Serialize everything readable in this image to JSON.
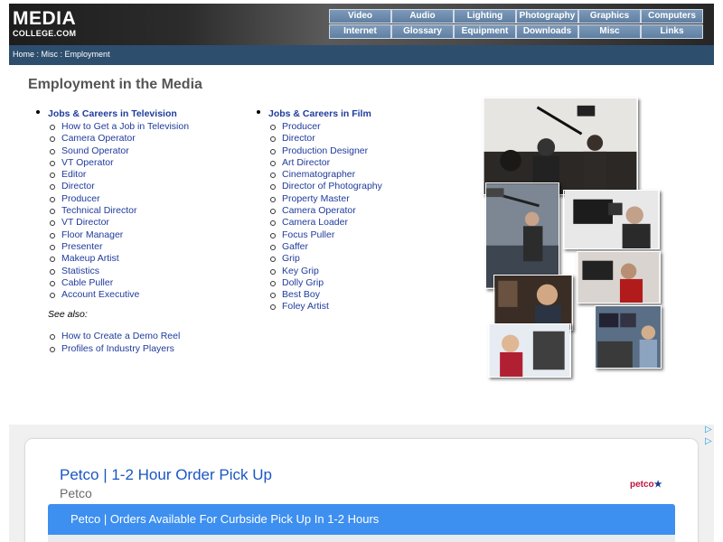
{
  "logo": {
    "line1": "MEDIA",
    "line2": "COLLEGE.COM"
  },
  "nav": [
    "Video",
    "Audio",
    "Lighting",
    "Photography",
    "Graphics",
    "Computers",
    "Internet",
    "Glossary",
    "Equipment",
    "Downloads",
    "Misc",
    "Links"
  ],
  "breadcrumb": {
    "home": "Home",
    "sep1": " : ",
    "misc": "Misc",
    "sep2": " : ",
    "current": "Employment"
  },
  "page_title": "Employment in the Media",
  "television": {
    "heading": "Jobs & Careers in Television",
    "items": [
      "How to Get a Job in Television",
      "Camera Operator",
      "Sound Operator",
      "VT Operator",
      "Editor",
      "Director",
      "Producer",
      "Technical Director",
      "VT Director",
      "Floor Manager",
      "Presenter",
      "Makeup Artist",
      "Statistics",
      "Cable Puller",
      "Account Executive"
    ],
    "see_also_label": "See also:",
    "see_also": [
      "How to Create a Demo Reel",
      "Profiles of Industry Players"
    ]
  },
  "film": {
    "heading": "Jobs & Careers in Film",
    "items": [
      "Producer",
      "Director",
      "Production Designer",
      "Art Director",
      "Cinematographer",
      "Director of Photography",
      "Property Master",
      "Camera Operator",
      "Camera Loader",
      "Focus Puller",
      "Gaffer",
      "Grip",
      "Key Grip",
      "Dolly Grip",
      "Best Boy",
      "Foley Artist"
    ]
  },
  "ad": {
    "title": "Petco | 1-2 Hour Order Pick Up",
    "advertiser": "Petco",
    "logo_text": "petco",
    "banner": "Petco | Orders Available For Curbside Pick Up In 1-2 Hours"
  },
  "colors": {
    "link": "#1f3b9c",
    "nav_button": "#6f8db0",
    "breadcrumb_bar": "#2e4e6e",
    "ad_blue": "#3d8ff0"
  }
}
